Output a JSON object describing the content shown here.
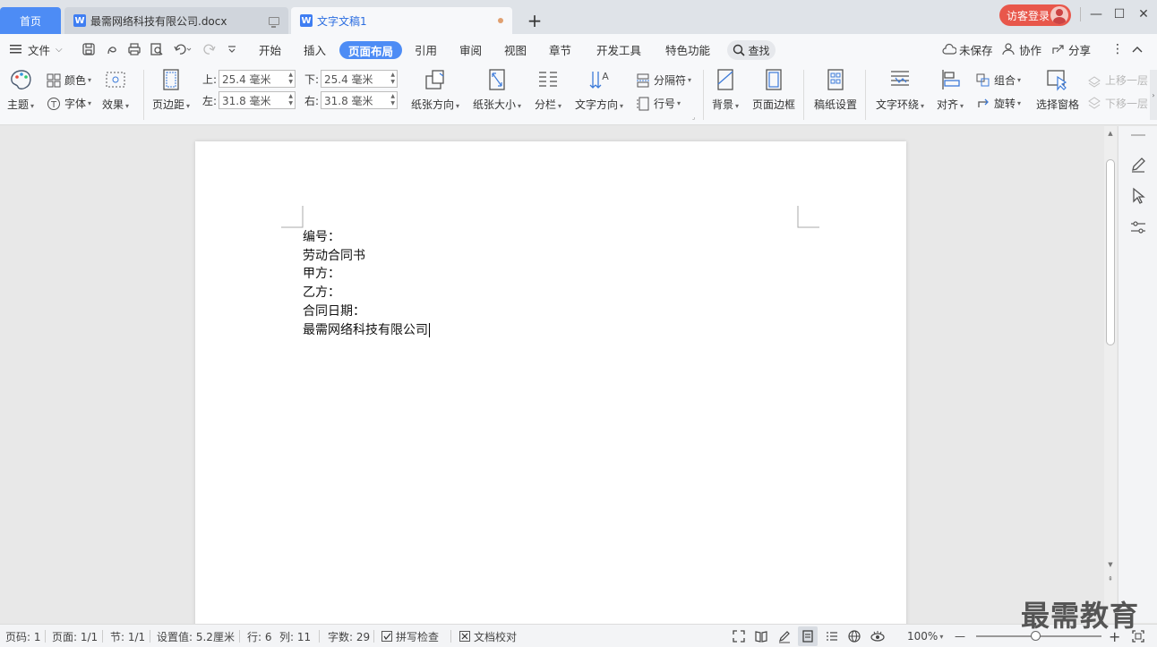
{
  "titlebar": {
    "home_tab": "首页",
    "tabs": [
      {
        "label": "最需网络科技有限公司.docx"
      },
      {
        "label": "文字文稿1"
      }
    ],
    "new_tab": "+",
    "login": "访客登录",
    "controls": {
      "minimize": "—",
      "maximize": "☐",
      "close": "✕"
    }
  },
  "menubar": {
    "file": "文件",
    "items": [
      "开始",
      "插入",
      "页面布局",
      "引用",
      "审阅",
      "视图",
      "章节",
      "开发工具",
      "特色功能"
    ],
    "active": "页面布局",
    "search": "查找",
    "right": {
      "unsaved": "未保存",
      "collab": "协作",
      "share": "分享"
    }
  },
  "ribbon": {
    "theme": "主题",
    "colors": "颜色",
    "fonts": "字体",
    "effects": "效果",
    "margins": "页边距",
    "margin_top_label": "上:",
    "margin_top": "25.4 毫米",
    "margin_bottom_label": "下:",
    "margin_bottom": "25.4 毫米",
    "margin_left_label": "左:",
    "margin_left": "31.8 毫米",
    "margin_right_label": "右:",
    "margin_right": "31.8 毫米",
    "orientation": "纸张方向",
    "size": "纸张大小",
    "columns": "分栏",
    "text_direction": "文字方向",
    "breaks": "分隔符",
    "line_numbers": "行号",
    "background": "背景",
    "page_border": "页面边框",
    "grid_paper": "稿纸设置",
    "wrap_text": "文字环绕",
    "align": "对齐",
    "group": "组合",
    "rotate": "旋转",
    "selection_pane": "选择窗格",
    "bring_forward": "上移一层",
    "send_backward": "下移一层"
  },
  "document": {
    "lines": [
      "编号：",
      "劳动合同书",
      "甲方：",
      "乙方：",
      "合同日期：",
      "最需网络科技有限公司"
    ]
  },
  "statusbar": {
    "page_num": "页码: 1",
    "pages": "页面: 1/1",
    "section": "节: 1/1",
    "setting": "设置值: 5.2厘米",
    "row": "行: 6",
    "col": "列: 11",
    "words": "字数: 29",
    "spell": "拼写检查",
    "proof": "文档校对",
    "zoom": "100%",
    "zoom_minus": "—",
    "zoom_plus": "+"
  },
  "watermark": "最需教育",
  "colors": {
    "accent": "#4d8cf5",
    "login": "#e8574b",
    "tab_active_text": "#2b6de0"
  }
}
